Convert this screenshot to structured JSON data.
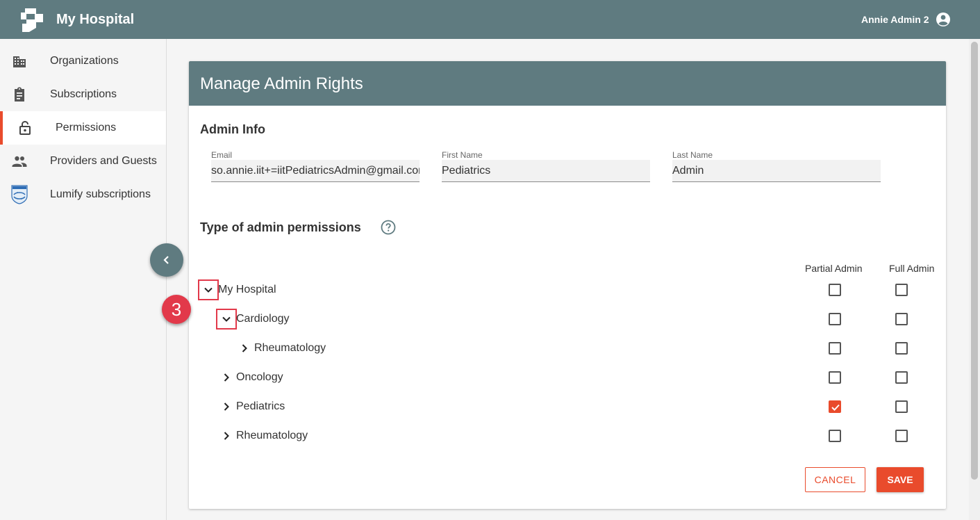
{
  "header": {
    "app_title": "My Hospital",
    "user_name": "Annie Admin 2",
    "logo_icon": "hospital-logo-icon",
    "user_icon": "account-circle-icon"
  },
  "sidebar": {
    "items": [
      {
        "label": "Organizations",
        "icon": "building-icon",
        "active": false
      },
      {
        "label": "Subscriptions",
        "icon": "clipboard-icon",
        "active": false
      },
      {
        "label": "Permissions",
        "icon": "lock-icon",
        "active": true
      },
      {
        "label": "Providers and Guests",
        "icon": "people-icon",
        "active": false
      },
      {
        "label": "Lumify subscriptions",
        "icon": "philips-shield-icon",
        "active": false
      }
    ]
  },
  "card": {
    "title": "Manage Admin Rights",
    "admin_info_title": "Admin Info",
    "fields": {
      "email": {
        "label": "Email",
        "value": "so.annie.iit+=iitPediatricsAdmin@gmail.com"
      },
      "first_name": {
        "label": "First Name",
        "value": "Pediatrics"
      },
      "last_name": {
        "label": "Last Name",
        "value": "Admin"
      }
    },
    "permissions_title": "Type of admin permissions",
    "columns": {
      "partial": "Partial Admin",
      "full": "Full Admin"
    },
    "tree": [
      {
        "label": "My Hospital",
        "level": 0,
        "expanded": true,
        "partial": false,
        "full": false,
        "highlighted": true
      },
      {
        "label": "Cardiology",
        "level": 1,
        "expanded": true,
        "partial": false,
        "full": false,
        "highlighted": true
      },
      {
        "label": "Rheumatology",
        "level": 2,
        "expanded": false,
        "partial": false,
        "full": false,
        "highlighted": false
      },
      {
        "label": "Oncology",
        "level": 1,
        "expanded": false,
        "partial": false,
        "full": false,
        "highlighted": false
      },
      {
        "label": "Pediatrics",
        "level": 1,
        "expanded": false,
        "partial": true,
        "full": false,
        "highlighted": false
      },
      {
        "label": "Rheumatology",
        "level": 1,
        "expanded": false,
        "partial": false,
        "full": false,
        "highlighted": false
      }
    ],
    "cancel_label": "CANCEL",
    "save_label": "SAVE"
  },
  "annotation": {
    "step": "3"
  },
  "colors": {
    "header": "#5f7b80",
    "accent": "#e94b2c",
    "annotation": "#e2394a"
  }
}
